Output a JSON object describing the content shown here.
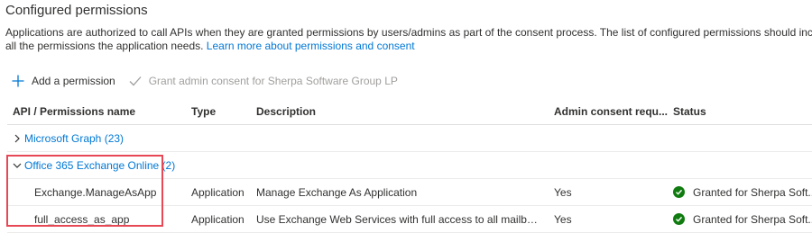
{
  "section": {
    "title": "Configured permissions",
    "description_line1": "Applications are authorized to call APIs when they are granted permissions by users/admins as part of the consent process. The list of configured permissions should inc",
    "description_line2_prefix": "all the permissions the application needs. ",
    "learn_more_link": "Learn more about permissions and consent"
  },
  "toolbar": {
    "add_permission": "Add a permission",
    "add_icon": "plus-icon",
    "grant_consent": "Grant admin consent for Sherpa Software Group LP",
    "grant_icon": "checkmark-icon"
  },
  "table": {
    "headers": {
      "name": "API / Permissions name",
      "type": "Type",
      "description": "Description",
      "admin": "Admin consent requ...",
      "status": "Status"
    },
    "groups": [
      {
        "label": "Microsoft Graph (23)",
        "expanded": false
      },
      {
        "label": "Office 365 Exchange Online (2)",
        "expanded": true
      }
    ],
    "rows": [
      {
        "name": "Exchange.ManageAsApp",
        "type": "Application",
        "description": "Manage Exchange As Application",
        "admin": "Yes",
        "status": "Granted for Sherpa Soft..."
      },
      {
        "name": "full_access_as_app",
        "type": "Application",
        "description": "Use Exchange Web Services with full access to all mailboxes",
        "admin": "Yes",
        "status": "Granted for Sherpa Soft..."
      }
    ]
  },
  "colors": {
    "link": "#0078d4",
    "granted": "#107c10",
    "highlight": "#e74856"
  }
}
